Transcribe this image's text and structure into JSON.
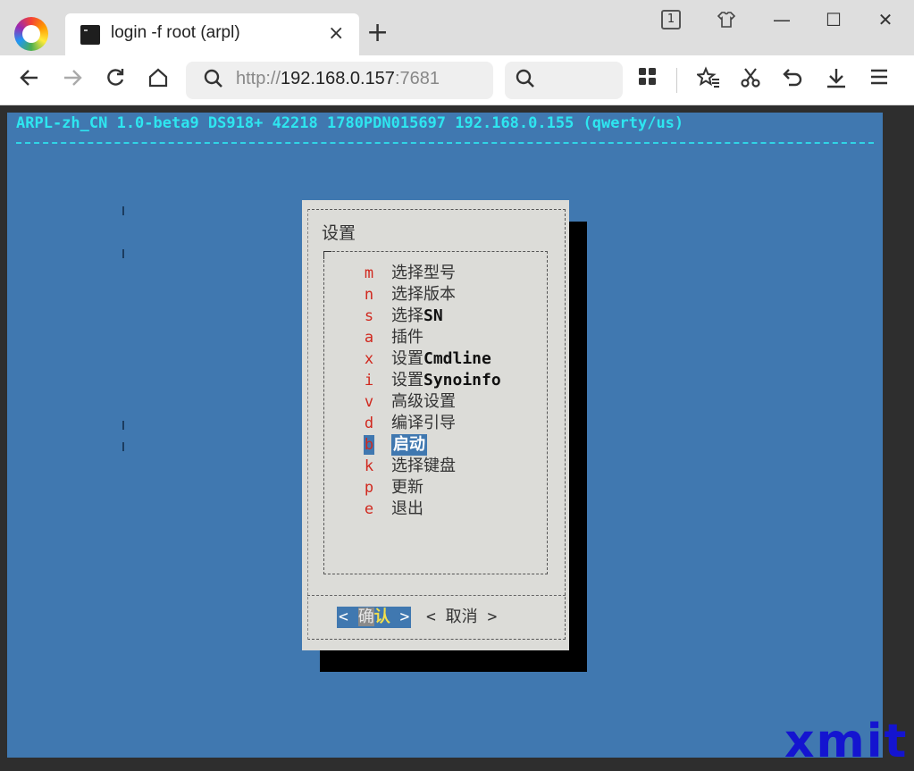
{
  "browser": {
    "tab": {
      "title": "login -f root (arpl)",
      "close": "×"
    },
    "new_tab": "+",
    "tab_count": "1",
    "window": {
      "minimize": "—",
      "maximize": "☐",
      "close": "✕"
    },
    "address": {
      "scheme": "http://",
      "host": "192.168.0.157",
      "port": ":7681"
    },
    "search_placeholder": ""
  },
  "terminal": {
    "header": "ARPL-zh_CN 1.0-beta9 DS918+ 42218 1780PDN015697 192.168.0.155 (qwerty/us)",
    "dialog": {
      "title": "设置",
      "items": [
        {
          "key": "m",
          "label": "选择型号"
        },
        {
          "key": "n",
          "label": "选择版本"
        },
        {
          "key": "s",
          "label": "选择",
          "suffix": "SN"
        },
        {
          "key": "a",
          "label": "插件"
        },
        {
          "key": "x",
          "label": "设置",
          "suffix": "Cmdline"
        },
        {
          "key": "i",
          "label": "设置",
          "suffix": "Synoinfo"
        },
        {
          "key": "v",
          "label": "高级设置"
        },
        {
          "key": "d",
          "label": "编译引导"
        },
        {
          "key": "b",
          "label": "启动",
          "selected": true
        },
        {
          "key": "k",
          "label": "选择键盘"
        },
        {
          "key": "p",
          "label": "更新"
        },
        {
          "key": "e",
          "label": "退出"
        }
      ],
      "ok_button": {
        "left": "<",
        "first": "确",
        "key": "认",
        "right": ">"
      },
      "cancel_button": "< 取消 >"
    }
  },
  "watermark": "xmit",
  "colors": {
    "terminal_bg": "#4078b0",
    "header_text": "#2ee6f0",
    "dialog_bg": "#dcdcd8",
    "hotkey": "#d0281e",
    "selection": "#4078b0"
  }
}
